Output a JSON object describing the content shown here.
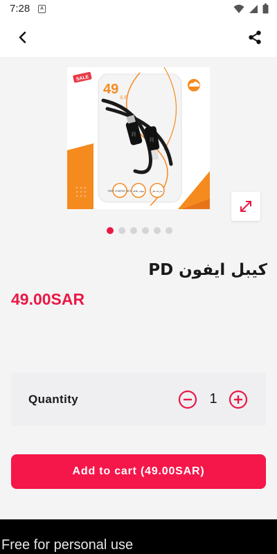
{
  "status_bar": {
    "time": "7:28",
    "notification_glyph": "A",
    "icons": [
      "wifi-icon",
      "signal-icon",
      "battery-icon"
    ]
  },
  "app_bar": {
    "back_icon": "chevron-left-icon",
    "share_icon": "share-icon"
  },
  "gallery": {
    "image_count": 6,
    "active_index": 0,
    "image_text": {
      "sale_sticker": "SALE",
      "price_number": "49",
      "price_unit": "S.R",
      "brand_letter": "R",
      "features": [
        "FAST CHARGE 18 W",
        "توفير طاقة",
        "سرعة نقل"
      ]
    },
    "expand_icon": "expand-arrows-icon"
  },
  "product": {
    "title": "كيبل ايفون PD",
    "price": "49.00SAR"
  },
  "quantity": {
    "label": "Quantity",
    "value": "1",
    "minus_icon": "minus-circle-icon",
    "plus_icon": "plus-circle-icon"
  },
  "cart": {
    "button_label": "Add to cart (49.00SAR)"
  },
  "footer": {
    "watermark": "Free for personal use"
  },
  "colors": {
    "accent": "#ea1844",
    "button": "#f5164a",
    "background": "#f4f4f5",
    "card": "#efeff2",
    "image_orange": "#f58a1f"
  }
}
